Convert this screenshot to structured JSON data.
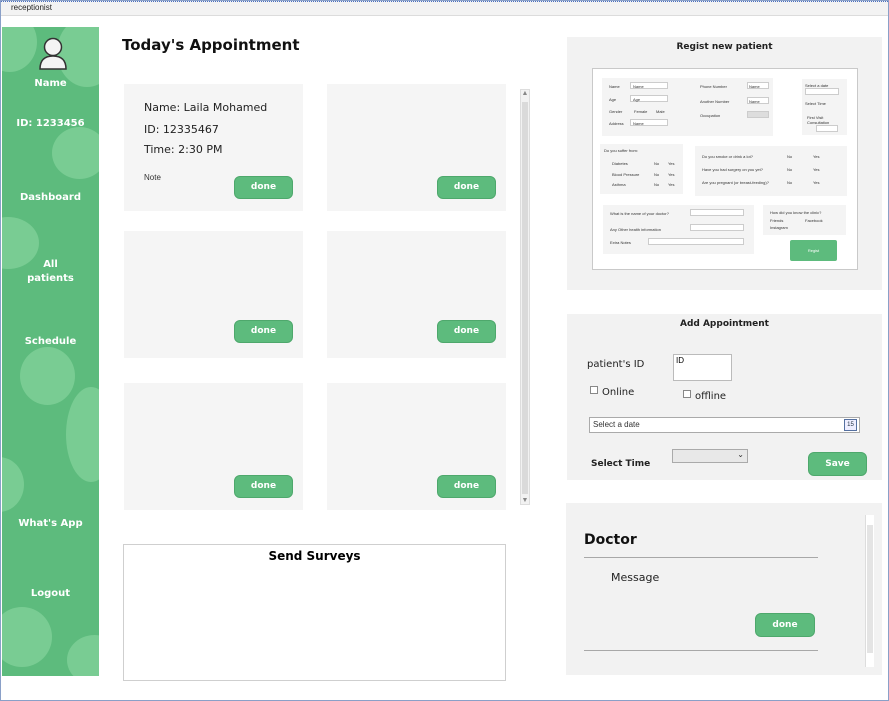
{
  "window": {
    "title": "receptionist"
  },
  "sidebar": {
    "name_label": "Name",
    "id_label": "ID: 1233456",
    "items": [
      {
        "label": "Dashboard"
      },
      {
        "label": "All patients"
      },
      {
        "label": "Schedule"
      },
      {
        "label": "What's App"
      },
      {
        "label": "Logout"
      }
    ],
    "all_patients_line1": "All",
    "all_patients_line2": "patients"
  },
  "appointments": {
    "title": "Today's Appointment",
    "cards": [
      {
        "name": "Name: Laila Mohamed",
        "id": "ID: 12335467",
        "time": "Time: 2:30 PM",
        "note": "Note",
        "button": "done"
      },
      {
        "name": "",
        "id": "",
        "time": "",
        "note": "",
        "button": "done"
      },
      {
        "name": "",
        "id": "",
        "time": "",
        "note": "",
        "button": "done"
      },
      {
        "name": "",
        "id": "",
        "time": "",
        "note": "",
        "button": "done"
      },
      {
        "name": "",
        "id": "",
        "time": "",
        "note": "",
        "button": "done"
      },
      {
        "name": "",
        "id": "",
        "time": "",
        "note": "",
        "button": "done"
      }
    ]
  },
  "surveys": {
    "title": "Send Surveys"
  },
  "register": {
    "title": "Regist new patient",
    "preview": {
      "fields_left": [
        "Name",
        "Age",
        "Gender",
        "Address"
      ],
      "fields_left_values": [
        "Name",
        "Age",
        "",
        "Name"
      ],
      "gender_options": [
        "Female",
        "Male"
      ],
      "fields_right": [
        "Phone Number",
        "Another Number",
        "Occupation"
      ],
      "fields_right_values": [
        "Name",
        "Name",
        ""
      ],
      "side_labels": [
        "Select a date",
        "Select Time",
        "First Visit",
        "Consultation"
      ],
      "conditions_title": "Do you suffer from:",
      "conditions": [
        "Diabetes",
        "Blood Pressure",
        "Asthma"
      ],
      "yes": "Yes",
      "no": "No",
      "questions": [
        "Do you smoke or drink a lot?",
        "Have you had surgery on you yet?",
        "Are you pregnant (or breast-feeding)?"
      ],
      "extra_labels": [
        "What is the name of your doctor?",
        "Any Other health information",
        "Extra Notes"
      ],
      "heard_title": "How did you know the clinic?",
      "heard_options": [
        "Friends",
        "Facebook",
        "Instagram"
      ],
      "button": "Regist"
    }
  },
  "add_appointment": {
    "title": "Add Appointment",
    "patient_id_label": "patient's ID",
    "patient_id_placeholder": "ID",
    "online_label": "Online",
    "offline_label": "offline",
    "date_placeholder": "Select a date",
    "calendar_day": "15",
    "select_time_label": "Select Time",
    "time_value": "",
    "save_button": "Save"
  },
  "doctor_panel": {
    "title": "Doctor",
    "message": "Message",
    "button": "done"
  },
  "colors": {
    "accent": "#5dbb7d",
    "sidebar_bubble": "#79cc93",
    "panel_bg": "#f2f2f2",
    "card_bg": "#f5f5f5"
  }
}
